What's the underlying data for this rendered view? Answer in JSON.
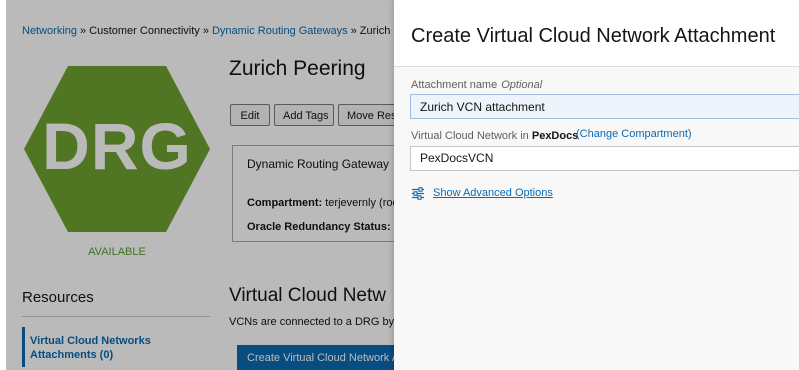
{
  "breadcrumb": {
    "items": [
      "Networking",
      "Customer Connectivity",
      "Dynamic Routing Gateways",
      "Zurich Pee"
    ],
    "separator": "»"
  },
  "resource": {
    "icon_text": "DRG",
    "status": "AVAILABLE",
    "title": "Zurich Peering"
  },
  "actions": {
    "edit": "Edit",
    "add_tags": "Add Tags",
    "move": "Move Res"
  },
  "info": {
    "type_label": "Dynamic Routing Gateway",
    "compartment_label": "Compartment:",
    "compartment_value": "terjevernly (roo",
    "redundancy_label": "Oracle Redundancy Status:",
    "redundancy_value": "-"
  },
  "resources": {
    "heading": "Resources",
    "items": [
      "Virtual Cloud Networks Attachments (0)"
    ]
  },
  "vcn_section": {
    "title": "Virtual Cloud Netw",
    "description": "VCNs are connected to a DRG by",
    "create_button": "Create Virtual Cloud Network A"
  },
  "panel": {
    "title": "Create Virtual Cloud Network Attachment",
    "attachment_name_label": "Attachment name",
    "optional_label": "Optional",
    "attachment_name_value": "Zurich VCN attachment",
    "vcn_label_prefix": "Virtual Cloud Network in",
    "vcn_compartment": "PexDocs",
    "change_compartment": "(Change Compartment)",
    "vcn_value": "PexDocsVCN",
    "advanced_options": "Show Advanced Options"
  },
  "colors": {
    "drg_green": "#6ea231",
    "status_green": "#5a9c32",
    "link_blue": "#0a6ab1",
    "primary_button": "#0a6ab1"
  }
}
